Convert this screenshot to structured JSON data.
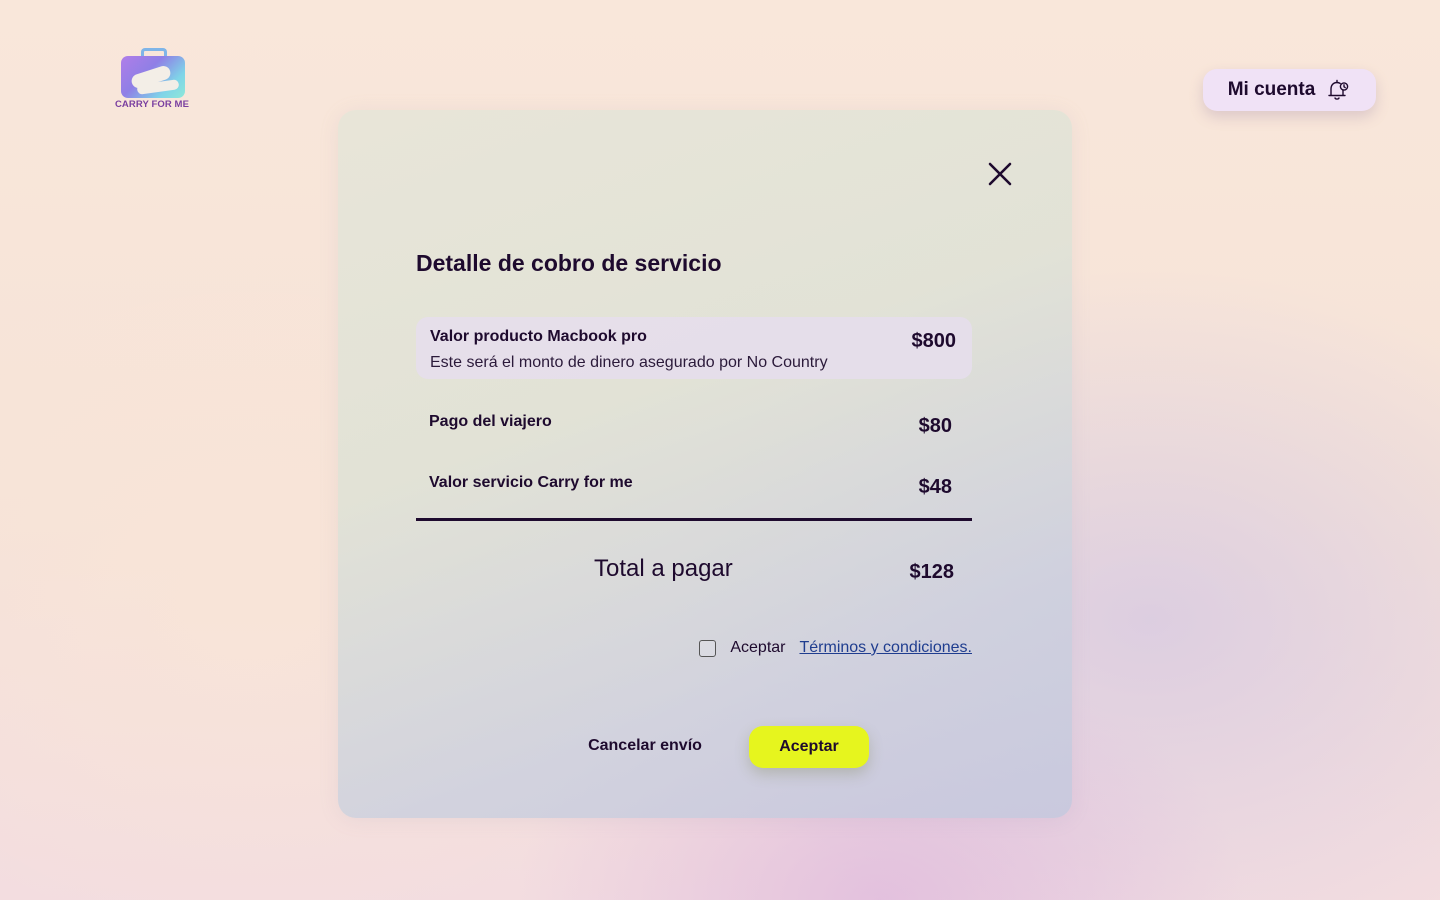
{
  "brand": {
    "logo_text": "CARRY FOR ME",
    "logo_icon": "suitcase-hug-icon"
  },
  "header": {
    "account_label": "Mi cuenta",
    "account_icon": "bell-icon"
  },
  "modal": {
    "close_icon": "close-icon",
    "title": "Detalle de cobro de servicio",
    "items": [
      {
        "label": "Valor producto Macbook pro",
        "description": "Este será el monto de dinero asegurado por No Country",
        "amount": "$800"
      },
      {
        "label": "Pago del viajero",
        "amount": "$80"
      },
      {
        "label": "Valor servicio Carry for me",
        "amount": "$48"
      }
    ],
    "total": {
      "label": "Total a pagar",
      "amount": "$128"
    },
    "terms": {
      "checked": false,
      "accept_text": "Aceptar",
      "link_text": "Términos y condiciones."
    },
    "actions": {
      "cancel_label": "Cancelar envío",
      "accept_label": "Aceptar"
    }
  },
  "colors": {
    "accent": "#e6f51e",
    "text": "#1e0a2e",
    "link": "#1f3d8f",
    "account_bg": "#f0e2f6"
  }
}
